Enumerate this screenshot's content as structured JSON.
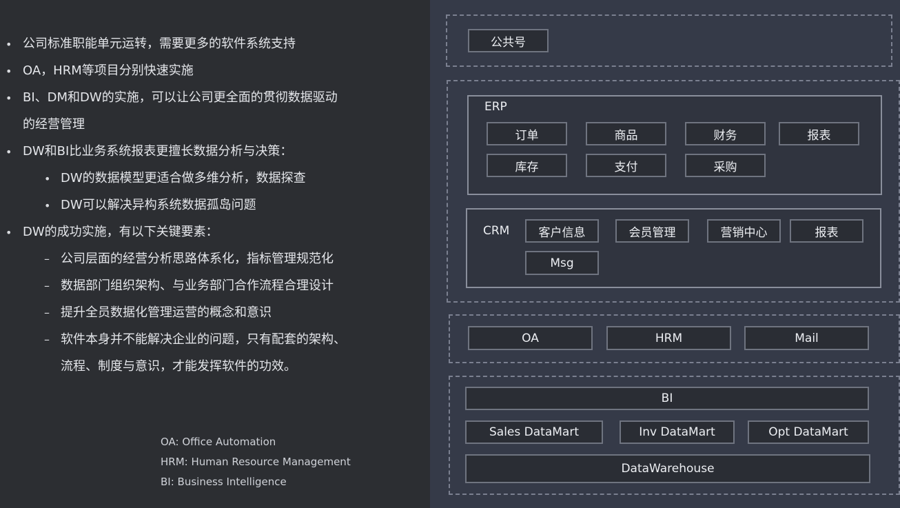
{
  "bullets": [
    "公司标准职能单元运转，需要更多的软件系统支持",
    "OA，HRM等项目分别快速实施",
    "BI、DM和DW的实施，可以让公司更全面的贯彻数据驱动",
    "的经营管理",
    "DW和BI比业务系统报表更擅长数据分析与决策：",
    "DW的数据模型更适合做多维分析，数据探查",
    "DW可以解决异构系统数据孤岛问题",
    "DW的成功实施，有以下关键要素：",
    "公司层面的经营分析思路体系化，指标管理规范化",
    "数据部门组织架构、与业务部门合作流程合理设计",
    "提升全员数据化管理运营的概念和意识",
    "软件本身并不能解决企业的问题，只有配套的架构、",
    "流程、制度与意识，才能发挥软件的功效。"
  ],
  "markers": {
    "dot": "•",
    "dash": "–"
  },
  "legend": [
    "OA: Office Automation",
    "HRM: Human Resource Management",
    "BI: Business Intelligence"
  ],
  "diagram": {
    "public": "公共号",
    "erp": {
      "label": "ERP",
      "modules": [
        "订单",
        "商品",
        "财务",
        "报表",
        "库存",
        "支付",
        "采购"
      ]
    },
    "crm": {
      "label": "CRM",
      "modules": [
        "客户信息",
        "会员管理",
        "营销中心",
        "报表",
        "Msg"
      ]
    },
    "office": [
      "OA",
      "HRM",
      "Mail"
    ],
    "bi": "BI",
    "datamarts": [
      "Sales DataMart",
      "Inv DataMart",
      "Opt DataMart"
    ],
    "dw": "DataWarehouse"
  },
  "colors": {
    "left_bg": "#2c2e32",
    "right_bg": "#353a48",
    "box_bg": "#2a2d34",
    "border": "#8a8f9c"
  }
}
